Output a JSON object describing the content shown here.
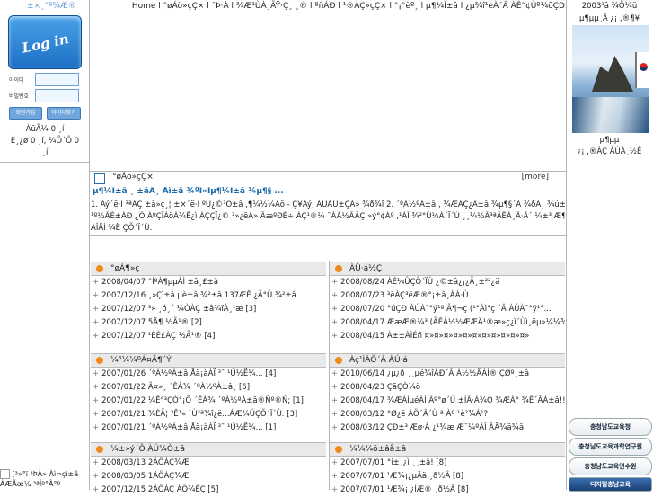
{
  "left": {
    "logo_text": "±×¸°º¾Æ®",
    "login_button": "Log in",
    "id_label": "아이디",
    "pw_label": "비밀번호",
    "btn_join": "회원가입",
    "btn_find": "아이디찾기",
    "info_lines": [
      "ÀüÃ¼ 0 ¸í",
      "È¸¿ø 0 ¸í, ¼Õ´Ô 0",
      "¸í"
    ]
  },
  "nav": {
    "text": "Home l °øÁö»çÇ× l ¯Þ·À l ¾Æ¹ÙÀ¸ÃŸ·Ç¸ ¸® l ºñÁÐ l ¹®ÀÇ»çÇ× l °¡°èº¸ l µ¶¼Ì±â l ¿µ¾î¹èÀ´Â ÀÊ°¢Ùº¼õÇD"
  },
  "right": {
    "date": "2003³â ¾Ö¼ü",
    "title": "µ¶µµ¸Â ¿¡ ,®¶¥",
    "caption_lines": [
      "µ¶µµ",
      "¿¡ ,®ÀÇ ÀÚÀ¸½Ê"
    ],
    "banners": [
      "충청남도교육청",
      "충청남도교육과학연구원",
      "충청남도교육연수원",
      "디지털충남교육"
    ]
  },
  "notice": {
    "header": "°øÁö»çÇ×",
    "more": "[more]",
    "title": "µ¶¼Ì±â ¸ ±âÃ¸ Åì±â ¾ºÌ»Ìµ¶¼Ì±â ¾µ¶§ ...",
    "body_lines": [
      "1. Àý´ë·Î ³ªÀÇ ±â»ç¸¦ ±×´ë·Î ºÙ¿©³Ö±â ,¶¼½¼Áö - Ç¥Àý, ÀÚÀÛ±ÇÀ» ¾ð¾î 2. ´ºÀ½ºÀ±â , ¾ÆÀÇ¿Â±â ¾µ¶§´Â ¾ðÀ¸ ¾ú±º¼´¨©°í",
      "¹º½ÃÈ±ÀÐ ¿Ö ÀºÇÏÁöÀ¾Ê¿ì ÀÇÇÏ¿© ³»¿ëÀ» ÃæºÐÈ÷ ÀÇ¹®¼ ¯ÀÃ½ÃÃÇ »ý°¢Àº ,¹ÀÎ ¾²°Ú½À´Ï´Ù ¸¸¼½Ã³ªÃÊÀ¸Ã·Ã´ ¼±³ Æ¶ö½´Ù ¹º½ÃÈ±¸É±",
      "ÀÎÅÍ ¾Ë ÇÕ´Ï´Ù."
    ]
  },
  "boards": [
    {
      "title": "°øÁ¶»ç",
      "rows": [
        {
          "date": "2008/04/07",
          "text": "°ÍºÀ¶µµÀÌ ±â¸£±â"
        },
        {
          "date": "2007/12/16",
          "text": "¸»Çì±â µè±â ¾²±â 137ÆÊ ¿Ã°Ú ¾²±â"
        },
        {
          "date": "2007/12/07",
          "text": "³» ¸ó¸´ ¼ÒÀÇ ±â¾ïÀ¸¹æ [3]"
        },
        {
          "date": "2007/12/07",
          "text": "5Ä¶ ½Ã¹® [2]"
        },
        {
          "date": "2007/12/07",
          "text": "¹ÈÈ£ÀÇ ½Ã¹® [4]"
        }
      ]
    },
    {
      "title": "ÀÚ·á½Ç",
      "rows": [
        {
          "date": "2008/08/24",
          "text": "ÀÉ¼ÛÇÕ´ÏÙ ¿©±â¿¡¿Ã¸±²²¿ä"
        },
        {
          "date": "2008/07/23",
          "text": "³ëÀÇ³ëÆ®°¡±â¸ÀÀ·Ù ."
        },
        {
          "date": "2008/07/20",
          "text": "°úÇÐ ÀÚÀ¯°ý¹º Ã¶¬ç (¹°Àì°ç ´Â ÀÚÀ¯°ý¹°..."
        },
        {
          "date": "2008/04/17",
          "text": "ÆæÆ®¼³ (ÃÊÀ½½ÆÆÄ¹®æ»ç¿ì´Ùì¸ëµ»¼¼¾ÃÃ·±â)"
        },
        {
          "date": "2008/04/15",
          "text": "À±±ÀÌÉñ ¤»¤»¤»¤»¤»¤»¤»¤»¤»¤»¤»"
        }
      ]
    },
    {
      "title": "¼³¼¼ºÁ¤Ã¶´Ý",
      "rows": [
        {
          "date": "2007/01/26",
          "text": "´ºÀ½ºÀ±â Åä¡àÀÏ ³¯ ¹Ù½Ë¼... [4]"
        },
        {
          "date": "2007/01/22",
          "text": "Ã¤»¸ ´ÊÀ¾ ´ºÀ½ºÀ±â¸ [6]"
        },
        {
          "date": "2007/01/22",
          "text": "¼Ê°³ÇÒ°¡Ô ´ÊÀ¾ ´ºÀ½ºÀ±â®Ñº®Ñ; [1]"
        },
        {
          "date": "2007/01/21",
          "text": "¾ÈÃ¦ ³Ê¹« ¹Ù³ª¾î¿ë...ÁÆ¼ÚÇÕ´Ï´Ù. [3]"
        },
        {
          "date": "2007/01/21",
          "text": "´ºÀ½ºÀ±â Åä¡àÀÏ ³¯ ¹Ù½Ë¼... [1]"
        }
      ]
    },
    {
      "title": "Àç¹ÌÀÖ´Â ÀÚ·á",
      "rows": [
        {
          "date": "2010/06/14",
          "text": "¿µ¿ð ¸¸µé¾îÀÐ´Â À½½ÄÀÌ® ÇØº¸±â"
        },
        {
          "date": "2008/04/23",
          "text": "ÇãÇÒ¼ö"
        },
        {
          "date": "2008/04/17",
          "text": "¾ÆÀÌµéÀÌ Àº°ø´Ù ±ÍÃ·Á¾Ò ¾ÆÀ° ¾Ê´ÂÁ±â!!! [1]"
        },
        {
          "date": "2008/03/12",
          "text": "°Ø¿ë ÀÖ´Â´Ù ª Àº ¹è²¾Á¹?"
        },
        {
          "date": "2008/03/12",
          "text": "ÇÐ±³ Æø·Â ¿¹¾æ Æ¯¼ºÀÎ ÂÄ¾ä¾ä"
        }
      ]
    },
    {
      "title": "¼±»ý´Ô ÀÚ¼Ò±â",
      "rows": [
        {
          "date": "2008/03/13",
          "text": "2ÁÖÀÇ¾Æ"
        },
        {
          "date": "2008/03/05",
          "text": "1ÁÖÀÇ¾Æ"
        },
        {
          "date": "2007/12/15",
          "text": "2ÁÖÀÇ ÁÖ¾ÈÇ [5]"
        }
      ]
    },
    {
      "title": "¼¼¼ö±âå±â",
      "rows": [
        {
          "date": "2007/07/01",
          "text": "°í±¸¿ì ¸¸±â! [8]"
        },
        {
          "date": "2007/07/01",
          "text": "¹Æ¾¡¿µÄä ¸ð½Â [8]"
        },
        {
          "date": "2007/07/01",
          "text": "¹Æ¾¡ ¿ÍÆ® ¸ð½Â [8]"
        }
      ]
    }
  ],
  "bottom_left": {
    "line1": "[³»°ï ³ÞÀ» Àì¬çì±â",
    "line2": "ÀÆÃæ¼­ ³ªÎº°Â°º"
  }
}
